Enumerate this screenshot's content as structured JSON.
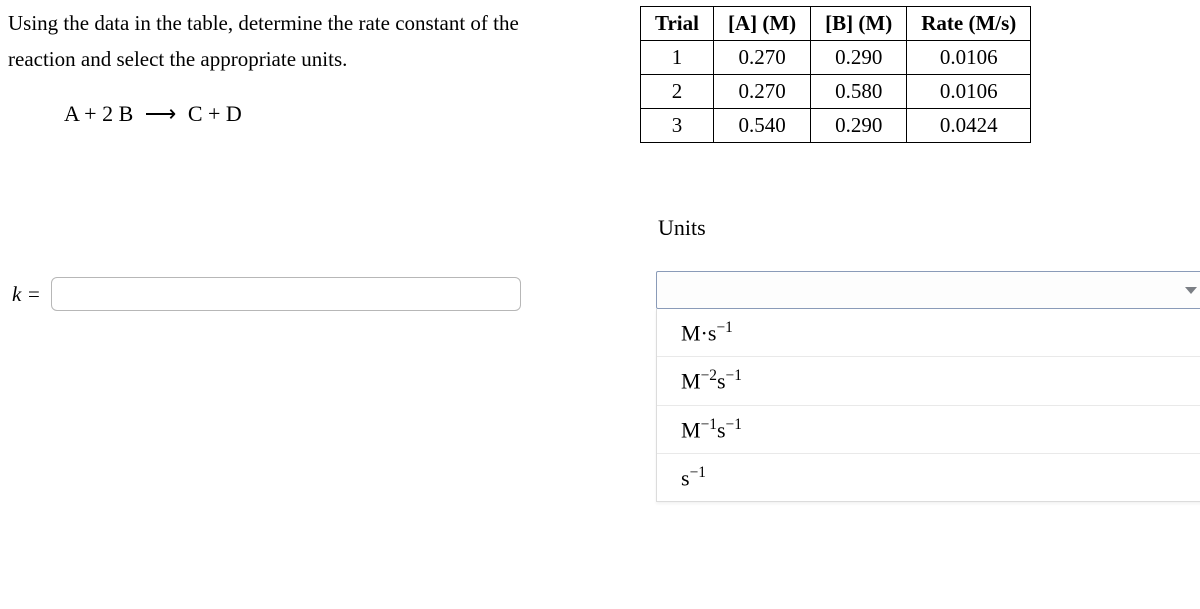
{
  "prompt": {
    "line1": "Using the data in the table, determine the rate constant of the",
    "line2": "reaction and select the appropriate units."
  },
  "equation": {
    "lhs": "A + 2 B",
    "arrow": "⟶",
    "rhs": "C + D"
  },
  "k": {
    "label": "k =",
    "value": ""
  },
  "table": {
    "headers": {
      "trial": "Trial",
      "a": "[A] (M)",
      "b": "[B] (M)",
      "rate": "Rate (M/s)"
    },
    "rows": [
      {
        "trial": "1",
        "a": "0.270",
        "b": "0.290",
        "rate": "0.0106"
      },
      {
        "trial": "2",
        "a": "0.270",
        "b": "0.580",
        "rate": "0.0106"
      },
      {
        "trial": "3",
        "a": "0.540",
        "b": "0.290",
        "rate": "0.0424"
      }
    ]
  },
  "units": {
    "label": "Units",
    "selected": "",
    "options_html": [
      "M·s<sup>−1</sup>",
      "M<sup>−2</sup>s<sup>−1</sup>",
      "M<sup>−1</sup>s<sup>−1</sup>",
      "s<sup>−1</sup>"
    ]
  }
}
